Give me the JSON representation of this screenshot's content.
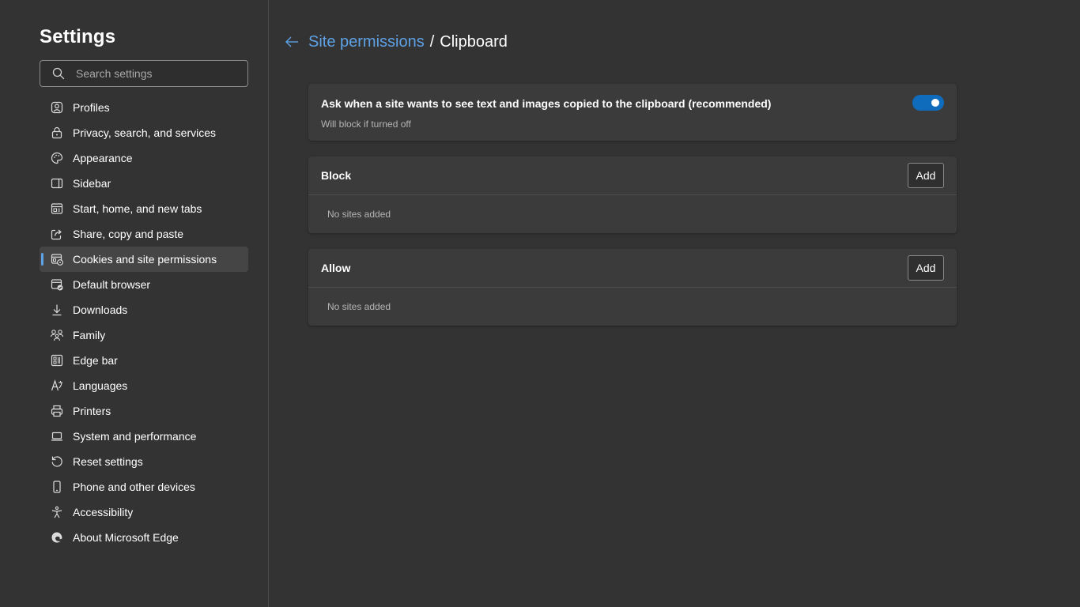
{
  "sidebar": {
    "title": "Settings",
    "search": {
      "placeholder": "Search settings",
      "value": "",
      "icon": "search-icon"
    },
    "items": [
      {
        "id": "profiles",
        "label": "Profiles",
        "icon": "profile-icon"
      },
      {
        "id": "privacy",
        "label": "Privacy, search, and services",
        "icon": "lock-icon"
      },
      {
        "id": "appearance",
        "label": "Appearance",
        "icon": "palette-icon"
      },
      {
        "id": "sidebar",
        "label": "Sidebar",
        "icon": "sidebar-icon"
      },
      {
        "id": "start-home",
        "label": "Start, home, and new tabs",
        "icon": "home-tabs-icon"
      },
      {
        "id": "share",
        "label": "Share, copy and paste",
        "icon": "share-icon"
      },
      {
        "id": "cookies",
        "label": "Cookies and site permissions",
        "icon": "cookies-permissions-icon",
        "active": true
      },
      {
        "id": "default-browser",
        "label": "Default browser",
        "icon": "default-browser-icon"
      },
      {
        "id": "downloads",
        "label": "Downloads",
        "icon": "download-icon"
      },
      {
        "id": "family",
        "label": "Family",
        "icon": "family-icon"
      },
      {
        "id": "edge-bar",
        "label": "Edge bar",
        "icon": "edge-bar-icon"
      },
      {
        "id": "languages",
        "label": "Languages",
        "icon": "languages-icon"
      },
      {
        "id": "printers",
        "label": "Printers",
        "icon": "printer-icon"
      },
      {
        "id": "system",
        "label": "System and performance",
        "icon": "laptop-icon"
      },
      {
        "id": "reset",
        "label": "Reset settings",
        "icon": "reset-icon"
      },
      {
        "id": "phone",
        "label": "Phone and other devices",
        "icon": "phone-icon"
      },
      {
        "id": "accessibility",
        "label": "Accessibility",
        "icon": "accessibility-icon"
      },
      {
        "id": "about",
        "label": "About Microsoft Edge",
        "icon": "edge-logo-icon"
      }
    ]
  },
  "header": {
    "back_icon": "back-arrow-icon",
    "breadcrumb_parent": "Site permissions",
    "separator": "/",
    "breadcrumb_current": "Clipboard"
  },
  "toggle_card": {
    "title": "Ask when a site wants to see text and images copied to the clipboard (recommended)",
    "subtitle": "Will block if turned off",
    "enabled": true
  },
  "block": {
    "title": "Block",
    "add_label": "Add",
    "empty_text": "No sites added"
  },
  "allow": {
    "title": "Allow",
    "add_label": "Add",
    "empty_text": "No sites added"
  },
  "colors": {
    "accent": "#5ea1e4",
    "toggle_on": "#0f6cbd",
    "background": "#333333",
    "card": "#3b3b3b"
  }
}
